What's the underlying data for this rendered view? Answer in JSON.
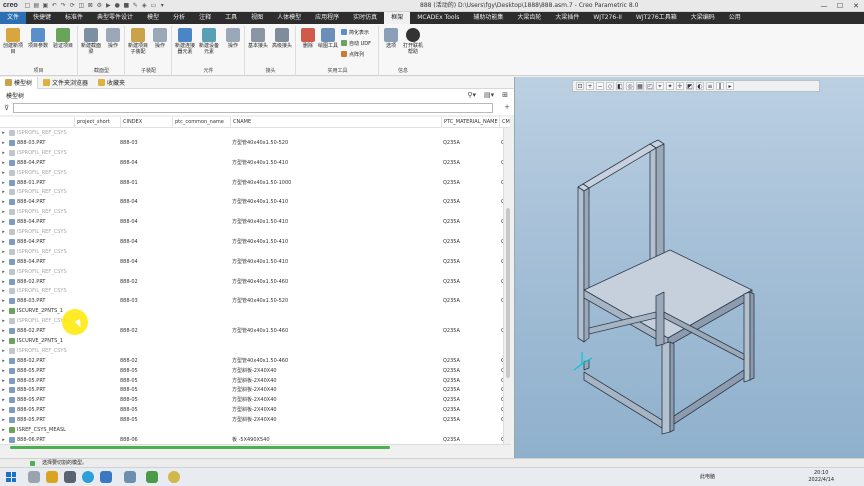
{
  "titlebar": {
    "logo": "creo",
    "title": "888 (活动的) D:\\Users\\fgy\\Desktop\\1888\\888.asm.7 - Creo Parametric 8.0",
    "min": "—",
    "max": "☐",
    "close": "✕"
  },
  "menu": {
    "items": [
      "文件",
      "快捷键",
      "标准件",
      "典型零件设计",
      "模型",
      "分析",
      "注释",
      "工具",
      "视图",
      "人体模型",
      "应用程序",
      "实时仿真",
      "框架",
      "MCADEx Tools",
      "辅助功能集",
      "大梁齿轮",
      "大梁插件",
      "WJT276-II",
      "WJT276工具箱",
      "大梁编码",
      "公用"
    ]
  },
  "ribbon": {
    "groups": [
      {
        "label": "项目",
        "buttons": [
          "创建新项目",
          "项目参数",
          "验证项目"
        ]
      },
      {
        "label": "截面型",
        "buttons": [
          "新建截面梁",
          "操作"
        ]
      },
      {
        "label": "子装配",
        "buttons": [
          "新建项目子装配",
          "操作"
        ]
      },
      {
        "label": "元件",
        "buttons": [
          "新建连接器元素",
          "新建设备元素",
          "操作"
        ]
      },
      {
        "label": "接头",
        "buttons": [
          "基本接头",
          "高级接头"
        ]
      },
      {
        "label": "实用工具",
        "buttons": [
          "删除",
          "绘图工具"
        ],
        "small": [
          "简化表示",
          "自动 UDF",
          "点阵列"
        ]
      },
      {
        "label": "信息",
        "buttons": [
          "选项",
          "打开联机帮助"
        ]
      }
    ]
  },
  "nav": {
    "tabs": [
      "模型树",
      "文件夹浏览器",
      "收藏夹"
    ],
    "tree_title": "模型树"
  },
  "columns": [
    "project_short",
    "CINDEX",
    "ptc_common_name",
    "CNAME",
    "PTC_MATERIAL_NAME",
    "CM"
  ],
  "rows": [
    {
      "name": "ISPROFIL_REF_CSYS",
      "cindex": "",
      "cname": "",
      "mat": "",
      "cm": "",
      "csys": true
    },
    {
      "name": "888-03.PRT",
      "cindex": "888-03",
      "cname": "方型管40x40x1.50-520",
      "mat": "Q235A",
      "cm": "C"
    },
    {
      "name": "ISPROFIL_REF_CSYS",
      "cindex": "",
      "cname": "",
      "mat": "",
      "cm": "",
      "csys": true
    },
    {
      "name": "888-04.PRT",
      "cindex": "888-04",
      "cname": "方型管40x40x1.50-410",
      "mat": "Q235A",
      "cm": "C"
    },
    {
      "name": "ISPROFIL_REF_CSYS",
      "cindex": "",
      "cname": "",
      "mat": "",
      "cm": "",
      "csys": true
    },
    {
      "name": "888-01.PRT",
      "cindex": "888-01",
      "cname": "方型管40x40x1.50-1000",
      "mat": "Q235A",
      "cm": "C"
    },
    {
      "name": "ISPROFIL_REF_CSYS",
      "cindex": "",
      "cname": "",
      "mat": "",
      "cm": "",
      "csys": true
    },
    {
      "name": "888-04.PRT",
      "cindex": "888-04",
      "cname": "方型管40x40x1.50-410",
      "mat": "Q235A",
      "cm": "C"
    },
    {
      "name": "ISPROFIL_REF_CSYS",
      "cindex": "",
      "cname": "",
      "mat": "",
      "cm": "",
      "csys": true
    },
    {
      "name": "888-04.PRT",
      "cindex": "888-04",
      "cname": "方型管40x40x1.50-410",
      "mat": "Q235A",
      "cm": "C"
    },
    {
      "name": "ISPROFIL_REF_CSYS",
      "cindex": "",
      "cname": "",
      "mat": "",
      "cm": "",
      "csys": true
    },
    {
      "name": "888-04.PRT",
      "cindex": "888-04",
      "cname": "方型管40x40x1.50-410",
      "mat": "Q235A",
      "cm": "C"
    },
    {
      "name": "ISPROFIL_REF_CSYS",
      "cindex": "",
      "cname": "",
      "mat": "",
      "cm": "",
      "csys": true
    },
    {
      "name": "888-04.PRT",
      "cindex": "888-04",
      "cname": "方型管40x40x1.50-410",
      "mat": "Q235A",
      "cm": "C"
    },
    {
      "name": "ISPROFIL_REF_CSYS",
      "cindex": "",
      "cname": "",
      "mat": "",
      "cm": "",
      "csys": true
    },
    {
      "name": "888-02.PRT",
      "cindex": "888-02",
      "cname": "方型管40x40x1.50-460",
      "mat": "Q235A",
      "cm": "C"
    },
    {
      "name": "ISPROFIL_REF_CSYS",
      "cindex": "",
      "cname": "",
      "mat": "",
      "cm": "",
      "csys": true
    },
    {
      "name": "888-03.PRT",
      "cindex": "888-03",
      "cname": "方型管40x40x1.50-520",
      "mat": "Q235A",
      "cm": "C"
    },
    {
      "name": "ISCURVE_2PNTS_1",
      "cindex": "",
      "cname": "",
      "mat": "",
      "cm": "",
      "csys": false
    },
    {
      "name": "ISPROFIL_REF_CSYS",
      "cindex": "",
      "cname": "",
      "mat": "",
      "cm": "",
      "csys": true
    },
    {
      "name": "888-02.PRT",
      "cindex": "888-02",
      "cname": "方型管40x40x1.50-460",
      "mat": "Q235A",
      "cm": "C"
    },
    {
      "name": "ISCURVE_2PNTS_1",
      "cindex": "",
      "cname": "",
      "mat": "",
      "cm": "",
      "csys": false
    },
    {
      "name": "ISPROFIL_REF_CSYS",
      "cindex": "",
      "cname": "",
      "mat": "",
      "cm": "",
      "csys": true
    },
    {
      "name": "888-02.PRT",
      "cindex": "888-02",
      "cname": "方型管40x40x1.50-460",
      "mat": "Q235A",
      "cm": "C"
    },
    {
      "name": "888-05.PRT",
      "cindex": "888-05",
      "cname": "方型斜板-2X40X40",
      "mat": "Q235A",
      "cm": "C"
    },
    {
      "name": "888-05.PRT",
      "cindex": "888-05",
      "cname": "方型斜板-2X40X40",
      "mat": "Q235A",
      "cm": "C"
    },
    {
      "name": "888-05.PRT",
      "cindex": "888-05",
      "cname": "方型斜板-2X40X40",
      "mat": "Q235A",
      "cm": "C"
    },
    {
      "name": "888-05.PRT",
      "cindex": "888-05",
      "cname": "方型斜板-2X40X40",
      "mat": "Q235A",
      "cm": "C"
    },
    {
      "name": "888-05.PRT",
      "cindex": "888-05",
      "cname": "方型斜板-2X40X40",
      "mat": "Q235A",
      "cm": "C"
    },
    {
      "name": "888-05.PRT",
      "cindex": "888-05",
      "cname": "方型斜板-2X40X40",
      "mat": "Q235A",
      "cm": "C"
    },
    {
      "name": "ISREF_CSYS_MEASL",
      "cindex": "",
      "cname": "",
      "mat": "",
      "cm": "",
      "csys": false
    },
    {
      "name": "888-06.PRT",
      "cindex": "888-06",
      "cname": "板 -5X490X540",
      "mat": "Q235A",
      "cm": "C"
    }
  ],
  "status": {
    "message": "选择要切割的模型。"
  },
  "taskbar": {
    "tray_text": "此电脑",
    "time": "20:10",
    "date": "2022/4/14"
  },
  "colors": {
    "menubar": "#2d2d2d",
    "file_tab": "#2c6fb3",
    "viewport_bg": "#a7c1d8",
    "chair": "#b9c4d2"
  }
}
